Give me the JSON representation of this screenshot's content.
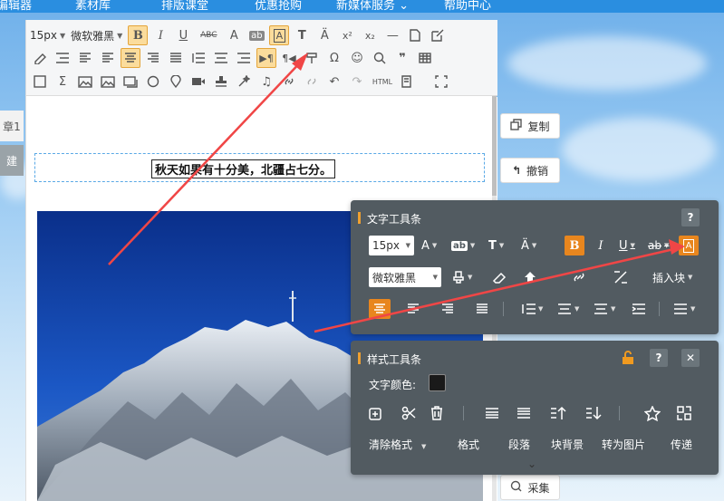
{
  "nav": {
    "items": [
      "编辑器",
      "素材库",
      "排版课堂",
      "优惠抢购",
      "新媒体服务 ⌄",
      "帮助中心"
    ]
  },
  "left_tabs": [
    "章1",
    "建"
  ],
  "toolbar": {
    "font_size": "15px",
    "font_family": "微软雅黑",
    "html_label": "HTML"
  },
  "document": {
    "title": "秋天如果有十分美，北疆占七分。"
  },
  "side_buttons": {
    "copy": "复制",
    "undo": "撤销",
    "collect": "采集"
  },
  "text_panel": {
    "title": "文字工具条",
    "help": "?",
    "font_size": "15px",
    "font_family": "微软雅黑",
    "insert_block": "插入块"
  },
  "style_panel": {
    "title": "样式工具条",
    "help": "?",
    "close": "✕",
    "text_color_label": "文字颜色:",
    "text_color": "#1a1a1a",
    "actions": [
      "清除格式",
      "格式",
      "段落",
      "块背景",
      "转为图片",
      "传递"
    ]
  },
  "colors": {
    "accent_orange": "#e8861e",
    "panel_bg": "#525b61",
    "nav_blue": "#2a8ee0",
    "arrow_red": "#f04646"
  }
}
